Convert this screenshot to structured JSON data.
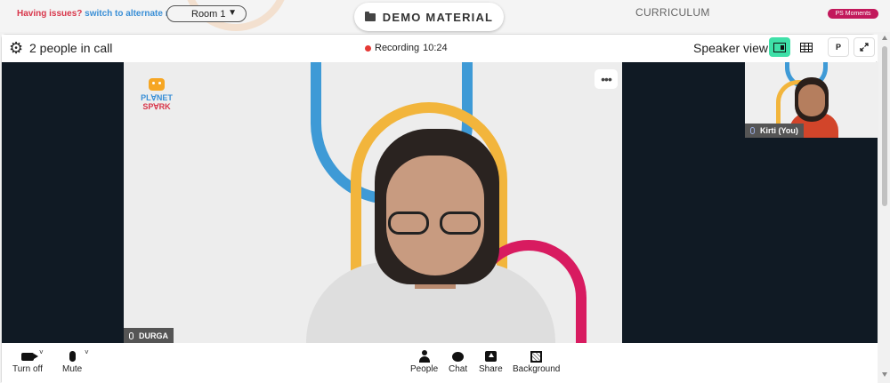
{
  "top": {
    "issues_question": "Having issues?",
    "issues_link": "switch to alternate room",
    "room_select": "Room 1",
    "demo_material": "DEMO MATERIAL",
    "curriculum": "CURRICULUM",
    "ps_moments": "PS Moments"
  },
  "call_header": {
    "people_in_call": "2 people in call",
    "recording_label": "Recording",
    "recording_time": "10:24",
    "view_mode": "Speaker view",
    "p_button": "P"
  },
  "main_video": {
    "participant_name": "DURGA",
    "logo_line1": "PL∀NET",
    "logo_line2": "SP∀RK",
    "more_label": "•••"
  },
  "self_video": {
    "participant_name": "Kirti (You)"
  },
  "toolbar": {
    "turn_off": "Turn off",
    "mute": "Mute",
    "people": "People",
    "chat": "Chat",
    "share": "Share",
    "background": "Background"
  },
  "colors": {
    "accent_green": "#3ee0a8",
    "record_red": "#e53935",
    "brand_pink": "#c2185b"
  }
}
